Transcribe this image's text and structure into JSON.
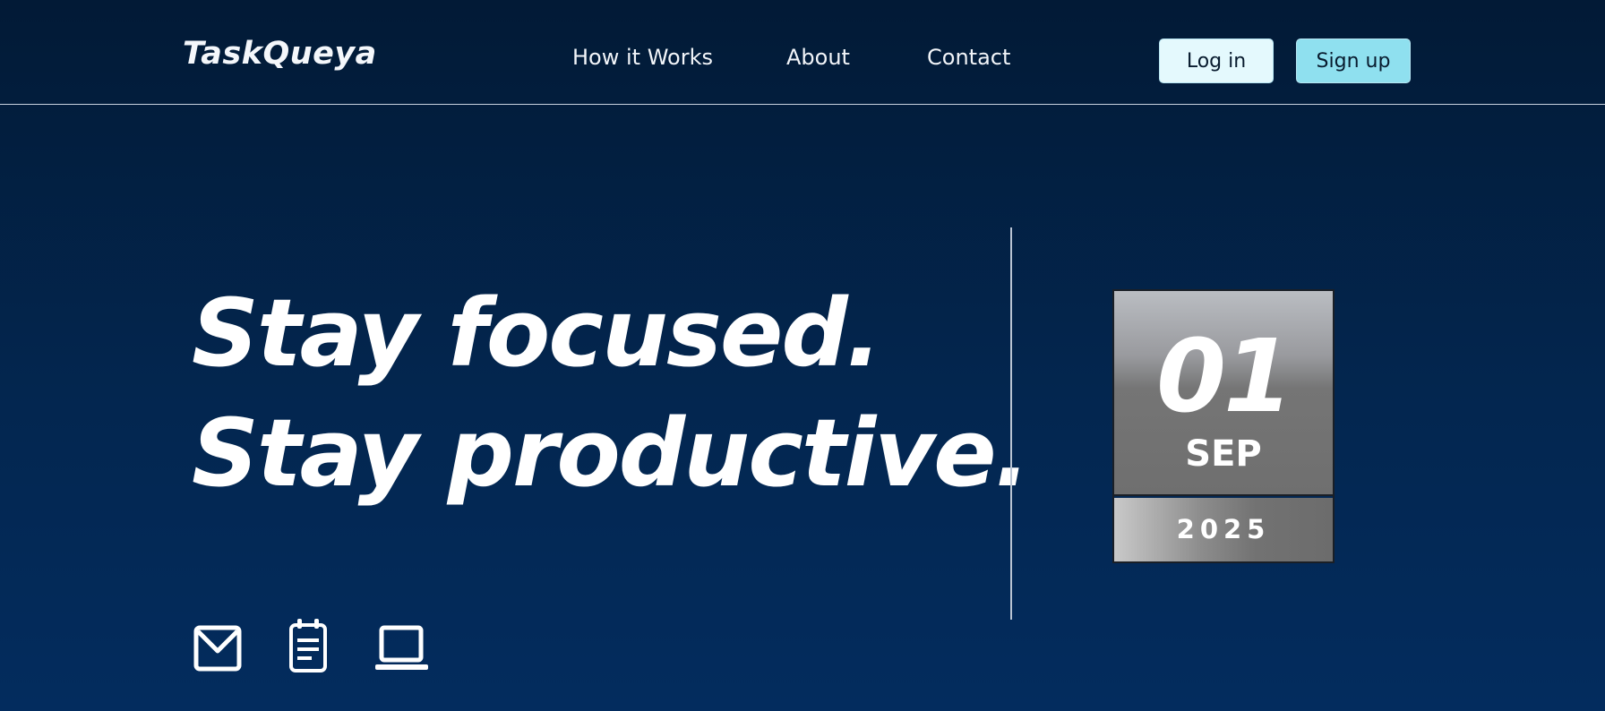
{
  "header": {
    "logo": "TaskQueya",
    "nav": [
      {
        "label": "How it Works"
      },
      {
        "label": "About"
      },
      {
        "label": "Contact"
      }
    ],
    "login_label": "Log in",
    "signup_label": "Sign up"
  },
  "hero": {
    "headline_line1": "Stay focused.",
    "headline_line2": "Stay productive."
  },
  "date_card": {
    "day": "01",
    "month": "SEP",
    "year": "2025"
  },
  "feature_icons": [
    "mail-icon",
    "notepad-icon",
    "laptop-icon"
  ],
  "colors": {
    "background_top": "#021a36",
    "background_bottom": "#032c5e",
    "login_bg": "#e4f9fd",
    "signup_bg": "#8fe0ef",
    "text": "#ffffff"
  }
}
